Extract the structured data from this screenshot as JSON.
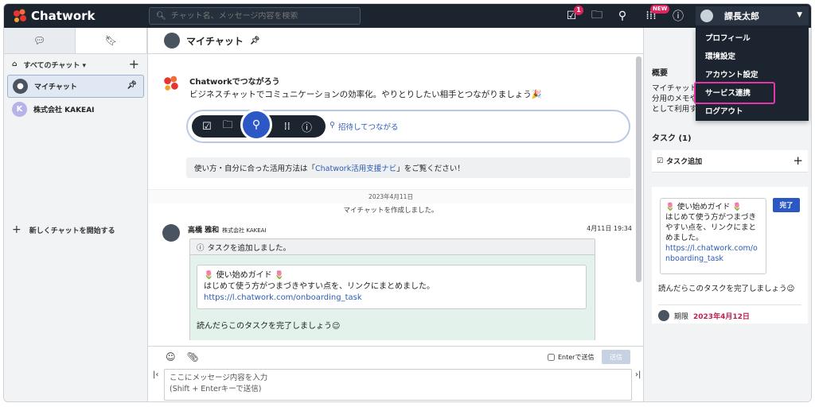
{
  "app": {
    "name": "Chatwork"
  },
  "topbar": {
    "search_placeholder": "チャット名、メッセージ内容を検索",
    "task_badge": "1",
    "new_badge": "NEW",
    "user_name": "課長太郎"
  },
  "user_menu": {
    "items": [
      "プロフィール",
      "環境設定",
      "アカウント設定",
      "サービス連携",
      "ログアウト"
    ],
    "highlighted": "サービス連携"
  },
  "sidebar": {
    "filter_label": "すべてのチャット ▾",
    "rooms": [
      {
        "name": "マイチャット",
        "active": true
      },
      {
        "name": "株式会社 KAKEAI",
        "avatar_letter": "K"
      }
    ],
    "new_chat_label": "新しくチャットを開始する"
  },
  "chat": {
    "title": "マイチャット",
    "welcome_title": "Chatworkでつながろう",
    "welcome_text": "ビジネスチャットでコミュニケーションの効率化。やりとりしたい相手とつながりましょう🎉",
    "invite_label": "招待してつながる",
    "guide_prefix": "使い方・自分に合った活用方法は「",
    "guide_link": "Chatwork活用支援ナビ",
    "guide_suffix": "」をご覧ください！",
    "date_divider": "2023年4月11日",
    "system_message": "マイチャットを作成しました。",
    "message": {
      "sender": "高橋 雅和",
      "org": "株式会社 KAKEAI",
      "time": "4月11日 19:34",
      "task_header": "タスクを追加しました。",
      "card_title": "🌷 使い始めガイド 🌷",
      "card_body": "はじめて使う方がつまづきやすい点を、リンクにまとめました。",
      "card_link": "https://l.chatwork.com/onboarding_task",
      "footer": "読んだらこのタスクを完了しましょう😉"
    }
  },
  "composer": {
    "enter_send_label": "Enterで送信",
    "send_label": "送信",
    "placeholder_line1": "ここにメッセージ内容を入力",
    "placeholder_line2": "(Shift + Enterキーで送信)"
  },
  "right_panel": {
    "overview_title": "概要",
    "overview_text": "マイチャット分用のメモやとして利用す",
    "tasks_title": "タスク (1)",
    "add_task_label": "タスク追加",
    "task_title": "🌷 使い始めガイド 🌷",
    "task_body": "はじめて使う方がつまづきやすい点を、リンクにまとめました。",
    "task_link": "https://l.chatwork.com/onboarding_task",
    "done_label": "完了",
    "task_footer": "読んだらこのタスクを完了しましょう😉",
    "deadline_label": "期限",
    "deadline_value": "2023年4月12日"
  },
  "colors": {
    "topbar": "#1c2430",
    "accent_blue": "#2b58c4",
    "highlight_pink": "#e535ab",
    "logo_red": "#e5352d"
  }
}
